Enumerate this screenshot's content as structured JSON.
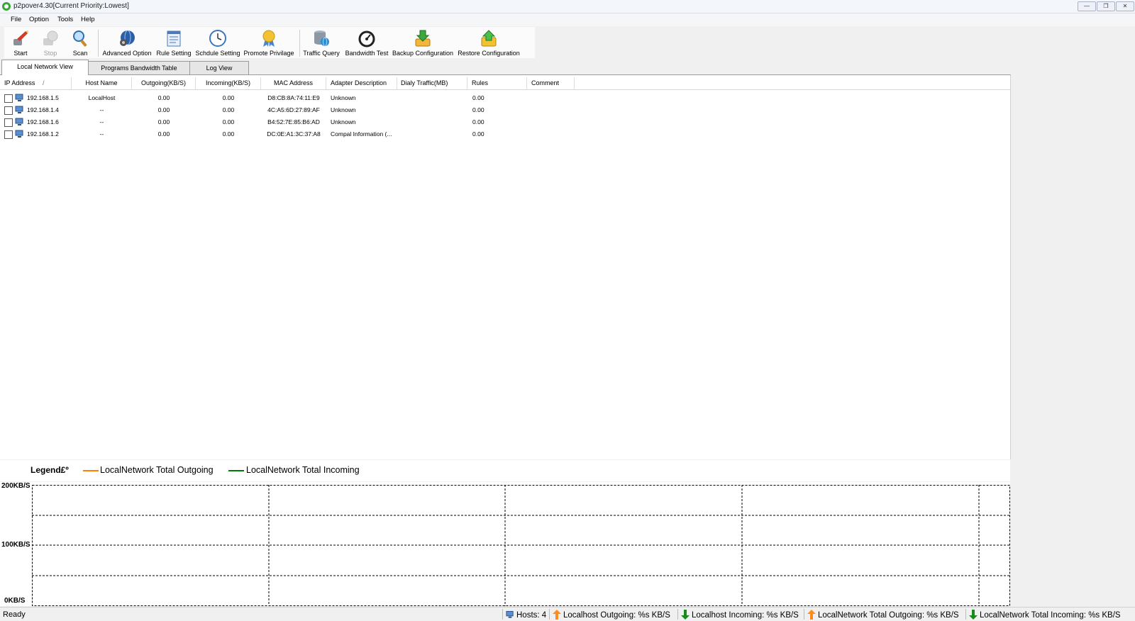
{
  "window": {
    "title": "p2pover4.30[Current Priority:Lowest]"
  },
  "menu": [
    "File",
    "Option",
    "Tools",
    "Help"
  ],
  "toolbar": {
    "start": "Start",
    "stop": "Stop",
    "scan": "Scan",
    "advanced": "Advanced Option",
    "rule": "Rule Setting",
    "schedule": "Schdule Setting",
    "privilege": "Promote Privilage",
    "traffic": "Traffic Query",
    "bandwidth": "Bandwidth Test",
    "backup": "Backup Configuration",
    "restore": "Restore Configuration"
  },
  "tabs": [
    "Local Network View",
    "Programs Bandwidth Table",
    "Log View"
  ],
  "table": {
    "headers": [
      "IP Address",
      "Host Name",
      "Outgoing(KB/S)",
      "Incoming(KB/S)",
      "MAC Address",
      "Adapter Description",
      "Dialy Traffic(MB)",
      "Rules",
      "Comment"
    ],
    "rows": [
      {
        "ip": "192.168.1.5",
        "host": "LocalHost",
        "out": "0.00",
        "in": "0.00",
        "mac": "D8:CB:8A:74:11:E9",
        "adapter": "Unknown",
        "rules": "0.00"
      },
      {
        "ip": "192.168.1.4",
        "host": "--",
        "out": "0.00",
        "in": "0.00",
        "mac": "4C:A5:6D:27:89:AF",
        "adapter": "Unknown",
        "rules": "0.00"
      },
      {
        "ip": "192.168.1.6",
        "host": "--",
        "out": "0.00",
        "in": "0.00",
        "mac": "B4:52:7E:85:B6:AD",
        "adapter": "Unknown",
        "rules": "0.00"
      },
      {
        "ip": "192.168.1.2",
        "host": "--",
        "out": "0.00",
        "in": "0.00",
        "mac": "DC:0E:A1:3C:37:A8",
        "adapter": "Compal Information (...",
        "rules": "0.00"
      }
    ]
  },
  "legend": {
    "title": "Legend£º",
    "outgoing": "LocalNetwork Total Outgoing",
    "incoming": "LocalNetwork Total Incoming",
    "outgoing_color": "#ff7f00",
    "incoming_color": "#007a00"
  },
  "graph": {
    "y_labels": [
      "200KB/S",
      "100KB/S",
      "0KB/S"
    ]
  },
  "status": {
    "ready": "Ready",
    "hosts": "Hosts: 4",
    "lh_out": "Localhost Outgoing: %s KB/S",
    "lh_in": "Localhost Incoming: %s KB/S",
    "ln_out": "LocalNetwork Total Outgoing: %s KB/S",
    "ln_in": "LocalNetwork Total Incoming: %s KB/S"
  }
}
